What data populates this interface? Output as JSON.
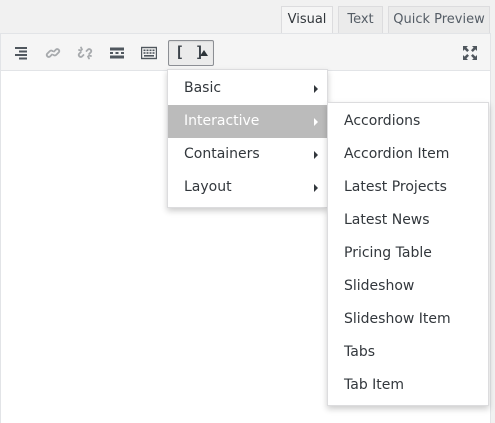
{
  "tabs": [
    {
      "label": "Visual",
      "active": true
    },
    {
      "label": "Text",
      "active": false
    },
    {
      "label": "Quick Preview",
      "active": false
    }
  ],
  "toolbar": {
    "buttons": [
      "align-right-icon",
      "insert-link-icon",
      "remove-link-icon",
      "read-more-icon",
      "toolbar-toggle-icon",
      "shortcodes-icon",
      "fullscreen-icon"
    ],
    "shortcode_label": "[ ]"
  },
  "menu": {
    "items": [
      {
        "label": "Basic",
        "has_submenu": true,
        "active": false
      },
      {
        "label": "Interactive",
        "has_submenu": true,
        "active": true
      },
      {
        "label": "Containers",
        "has_submenu": true,
        "active": false
      },
      {
        "label": "Layout",
        "has_submenu": true,
        "active": false
      }
    ]
  },
  "submenu": {
    "items": [
      {
        "label": "Accordions"
      },
      {
        "label": "Accordion Item"
      },
      {
        "label": "Latest Projects"
      },
      {
        "label": "Latest News"
      },
      {
        "label": "Pricing Table"
      },
      {
        "label": "Slideshow"
      },
      {
        "label": "Slideshow Item"
      },
      {
        "label": "Tabs"
      },
      {
        "label": "Tab Item"
      }
    ]
  },
  "colors": {
    "active_item_bg": "#bbbbbb",
    "toolbar_bg": "#f5f5f5",
    "text": "#32373c"
  }
}
